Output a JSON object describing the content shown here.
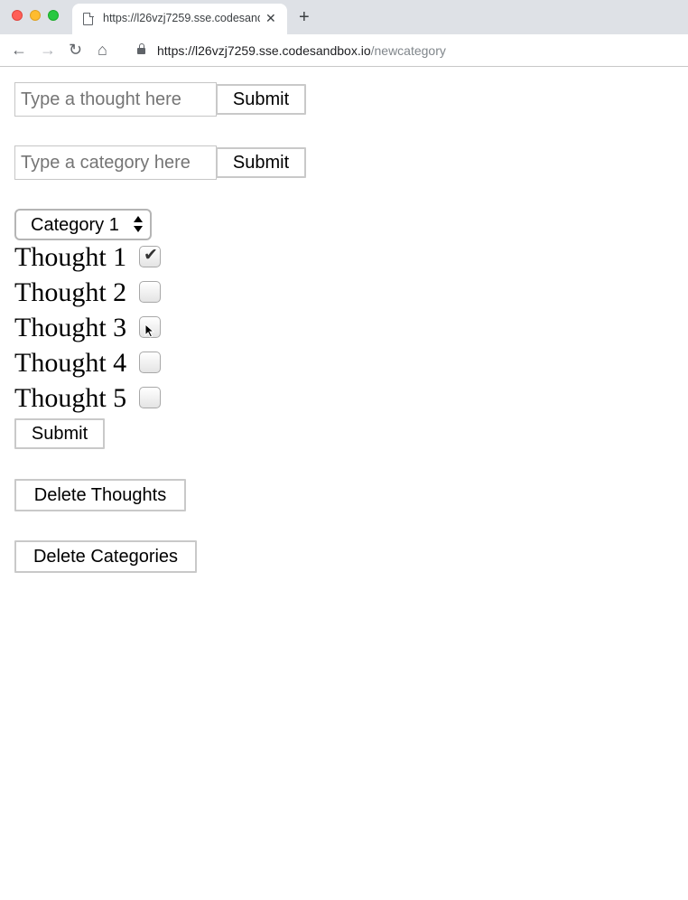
{
  "browser": {
    "tab_title": "https://l26vzj7259.sse.codesandbox.io/newcategory",
    "tab_close": "✕",
    "new_tab": "+",
    "url_host": "https://l26vzj7259.sse.codesandbox.io",
    "url_path": "/newcategory",
    "icons": {
      "back": "←",
      "forward": "→",
      "reload": "↻",
      "home": "⌂"
    }
  },
  "thought_form": {
    "placeholder": "Type a thought here",
    "submit_label": "Submit"
  },
  "category_form": {
    "placeholder": "Type a category here",
    "submit_label": "Submit"
  },
  "category_select": {
    "selected": "Category 1"
  },
  "thoughts": [
    {
      "label": "Thought 1",
      "checked": true
    },
    {
      "label": "Thought 2",
      "checked": false
    },
    {
      "label": "Thought 3",
      "checked": false
    },
    {
      "label": "Thought 4",
      "checked": false
    },
    {
      "label": "Thought 5",
      "checked": false
    }
  ],
  "check_glyph": "✔",
  "assign_submit_label": "Submit",
  "delete_thoughts_label": "Delete Thoughts",
  "delete_categories_label": "Delete Categories"
}
